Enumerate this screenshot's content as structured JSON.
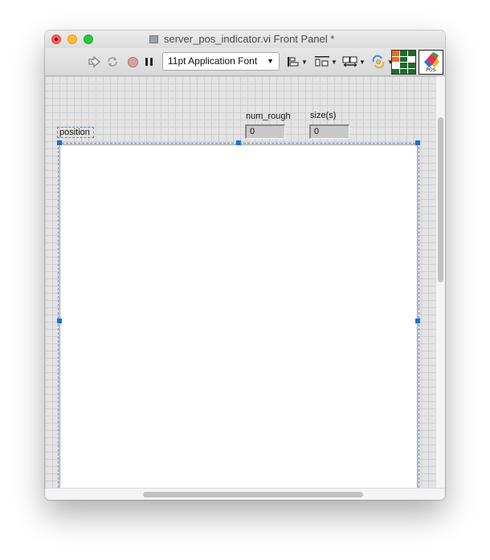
{
  "window": {
    "title": "server_pos_indicator.vi Front Panel *"
  },
  "toolbar": {
    "font_selector": "11pt Application Font",
    "icons": [
      "run-arrow-icon",
      "run-continuously-icon",
      "abort-icon",
      "pause-icon",
      "align-objects-icon",
      "distribute-objects-icon",
      "resize-objects-icon",
      "reorder-icon",
      "connector-pane-icon",
      "vi-icon"
    ],
    "vi_icon_label": "POS",
    "colors": {
      "abort": "#d9a3a6",
      "connector_green": "#1e6b2e",
      "connector_orange": "#f06a1f"
    }
  },
  "panel": {
    "graph_label": "position",
    "indicators": [
      {
        "label": "num_rough",
        "value": "0"
      },
      {
        "label": "size(s)",
        "value": "0"
      }
    ],
    "selection_color": "#1e6fd6"
  }
}
